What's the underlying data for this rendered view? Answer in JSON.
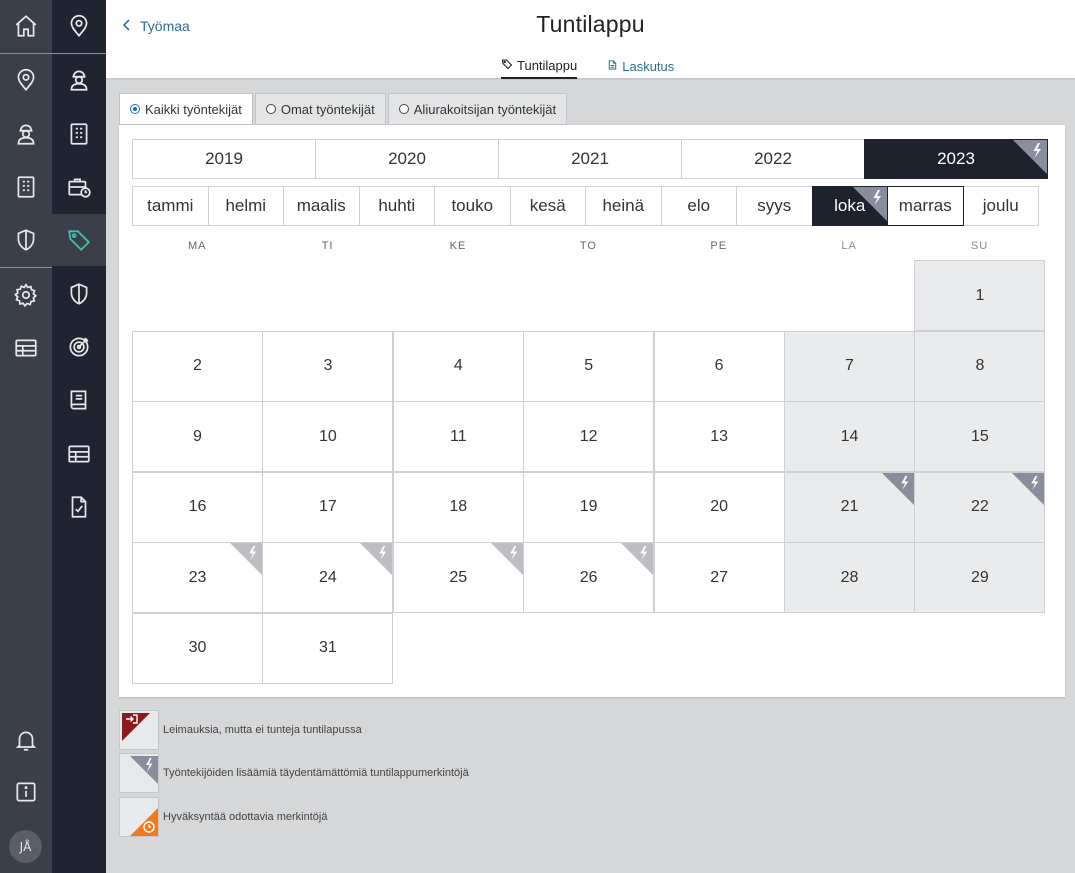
{
  "rail": {
    "user_initials": "JÅ"
  },
  "header": {
    "back_label": "Työmaa",
    "title": "Tuntilappu",
    "tabs": [
      {
        "label": "Tuntilappu",
        "icon": "tag-icon",
        "active": true
      },
      {
        "label": "Laskutus",
        "icon": "document-icon",
        "active": false
      }
    ]
  },
  "filters": [
    {
      "label": "Kaikki työntekijät",
      "selected": true
    },
    {
      "label": "Omat työntekijät",
      "selected": false
    },
    {
      "label": "Aliurakoitsijan työntekijät",
      "selected": false
    }
  ],
  "years": [
    {
      "label": "2019",
      "active": false,
      "flag": false
    },
    {
      "label": "2020",
      "active": false,
      "flag": false
    },
    {
      "label": "2021",
      "active": false,
      "flag": false
    },
    {
      "label": "2022",
      "active": false,
      "flag": false
    },
    {
      "label": "2023",
      "active": true,
      "flag": true
    }
  ],
  "months": [
    {
      "label": "tammi",
      "active": false,
      "flag": false
    },
    {
      "label": "helmi",
      "active": false,
      "flag": false
    },
    {
      "label": "maalis",
      "active": false,
      "flag": false
    },
    {
      "label": "huhti",
      "active": false,
      "flag": false
    },
    {
      "label": "touko",
      "active": false,
      "flag": false
    },
    {
      "label": "kesä",
      "active": false,
      "flag": false
    },
    {
      "label": "heinä",
      "active": false,
      "flag": false
    },
    {
      "label": "elo",
      "active": false,
      "flag": false
    },
    {
      "label": "syys",
      "active": false,
      "flag": false
    },
    {
      "label": "loka",
      "active": true,
      "flag": true
    },
    {
      "label": "marras",
      "active": false,
      "flag": false,
      "outlined": true
    },
    {
      "label": "joulu",
      "active": false,
      "flag": false
    }
  ],
  "weekdays": [
    "MA",
    "TI",
    "KE",
    "TO",
    "PE",
    "LA",
    "SU"
  ],
  "calendar": {
    "first_weekday_index": 6,
    "days": [
      {
        "d": "1"
      },
      {
        "d": "2"
      },
      {
        "d": "3"
      },
      {
        "d": "4"
      },
      {
        "d": "5"
      },
      {
        "d": "6"
      },
      {
        "d": "7"
      },
      {
        "d": "8"
      },
      {
        "d": "9"
      },
      {
        "d": "10"
      },
      {
        "d": "11"
      },
      {
        "d": "12"
      },
      {
        "d": "13"
      },
      {
        "d": "14"
      },
      {
        "d": "15"
      },
      {
        "d": "16"
      },
      {
        "d": "17"
      },
      {
        "d": "18"
      },
      {
        "d": "19"
      },
      {
        "d": "20"
      },
      {
        "d": "21",
        "flag": "dark"
      },
      {
        "d": "22",
        "flag": "dark"
      },
      {
        "d": "23",
        "flag": "light"
      },
      {
        "d": "24",
        "flag": "light"
      },
      {
        "d": "25",
        "flag": "light"
      },
      {
        "d": "26",
        "flag": "light"
      },
      {
        "d": "27"
      },
      {
        "d": "28"
      },
      {
        "d": "29"
      },
      {
        "d": "30"
      },
      {
        "d": "31"
      }
    ]
  },
  "legend": [
    {
      "label": "Leimauksia, mutta ei tunteja tuntilapussa",
      "icon": "login-icon",
      "color": "#8b1a1a"
    },
    {
      "label": "Työntekijöiden lisäämiä täydentämättömiä tuntilappumerkintöjä",
      "icon": "lightning-icon",
      "color": "#8a8e9c"
    },
    {
      "label": "Hyväksyntää odottavia merkintöjä",
      "icon": "clock-icon",
      "color": "#f07b1e"
    }
  ],
  "colors": {
    "accent": "#2e6f8c",
    "active_bg": "#1e222d",
    "flag_dark": "#8a8e9c",
    "flag_light": "#bdbec1",
    "tag_active": "#3ec1a6"
  }
}
